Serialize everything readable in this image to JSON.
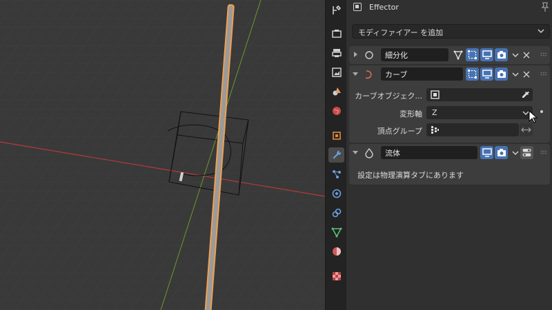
{
  "properties": {
    "context_name": "Effector",
    "add_modifier_label": "モディファイアー を追加",
    "modifiers": [
      {
        "name": "細分化",
        "expanded": false,
        "type_icon": "subdivision-icon"
      },
      {
        "name": "カーブ",
        "expanded": true,
        "type_icon": "curve-modifier-icon",
        "fields": {
          "curve_object_label": "カーブオブジェク...",
          "curve_object_value": "",
          "deform_axis_label": "変形軸",
          "deform_axis_value": "Z",
          "vertex_group_label": "頂点グループ",
          "vertex_group_value": ""
        }
      },
      {
        "name": "流体",
        "expanded": false,
        "type_icon": "fluid-icon",
        "info": "設定は物理演算タブにあります"
      }
    ]
  },
  "tabs": [
    "tool",
    "render",
    "output",
    "view-layer",
    "scene",
    "world",
    "object",
    "modifier",
    "particles",
    "physics",
    "constraints",
    "data",
    "material",
    "texture"
  ],
  "colors": {
    "accent_blue": "#4772b3",
    "selection_orange": "#f5a14a",
    "x_axis_red": "#b63a3a",
    "y_axis_green": "#6b9a2c"
  }
}
